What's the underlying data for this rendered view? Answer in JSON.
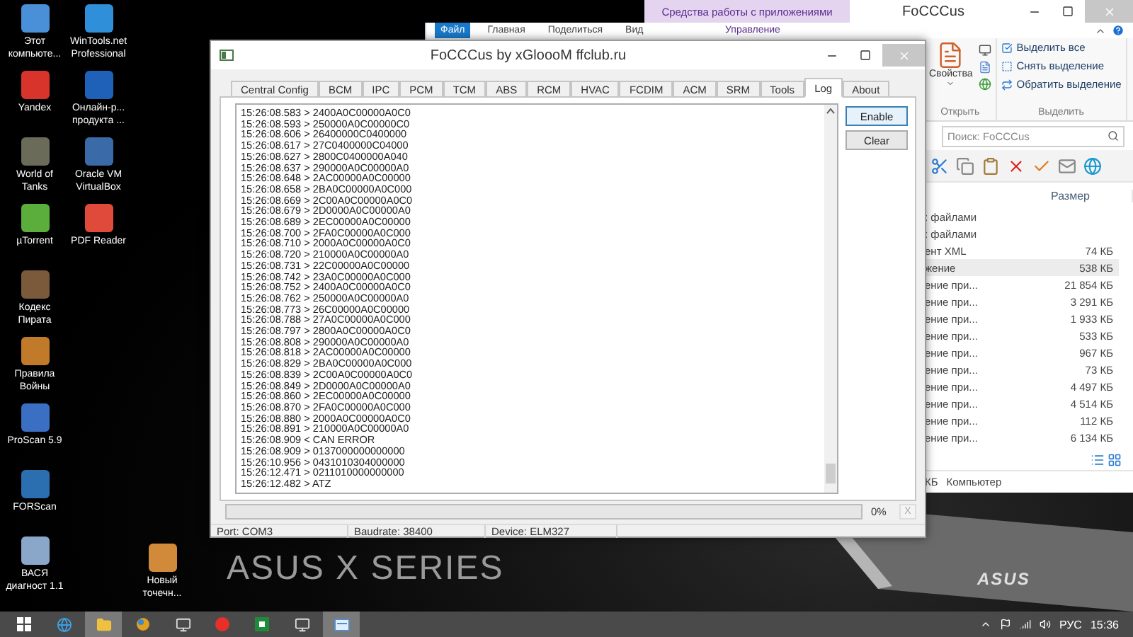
{
  "desktop": {
    "icon_columns": [
      [
        {
          "label": "Этот компьюте..."
        },
        {
          "label": "Yandex"
        },
        {
          "label": "World of Tanks"
        },
        {
          "label": "µTorrent"
        },
        {
          "label": "Кодекс Пирата"
        },
        {
          "label": "Правила Войны"
        },
        {
          "label": "ProScan 5.9"
        },
        {
          "label": "FORScan"
        },
        {
          "label": "ВАСЯ диагност 1.1"
        }
      ],
      [
        {
          "label": "WinTools.net Professional"
        },
        {
          "label": "Онлайн-р... продукта ..."
        },
        {
          "label": "Oracle VM VirtualBox"
        },
        {
          "label": "PDF Reader"
        }
      ],
      [
        {
          "label": "Новый точечн..."
        }
      ]
    ],
    "wallpaper": {
      "brand": "ASUS X SERIES",
      "laptop_logo": "ASUS"
    }
  },
  "explorer": {
    "context_header": "Средства работы с приложениями",
    "title": "FoCCCus",
    "tabs": [
      {
        "label": "Файл",
        "kind": "file"
      },
      {
        "label": "Главная",
        "kind": "plain"
      },
      {
        "label": "Поделиться",
        "kind": "plain"
      },
      {
        "label": "Вид",
        "kind": "plain"
      },
      {
        "label": "Управление",
        "kind": "context"
      }
    ],
    "ribbon": [
      {
        "label": "Открыть",
        "items": [
          {
            "label": "Свойства",
            "kind": "large"
          }
        ]
      },
      {
        "label": "Выделить",
        "items": [
          {
            "label": "Выделить все",
            "kind": "small"
          },
          {
            "label": "Снять выделение",
            "kind": "small"
          },
          {
            "label": "Обратить выделение",
            "kind": "small"
          }
        ]
      }
    ],
    "search": {
      "placeholder": "Поиск: FoCCCus"
    },
    "list": {
      "column": "Размер",
      "rows": [
        {
          "name": ": файлами",
          "selected": false
        },
        {
          "name": ": файлами",
          "selected": false
        },
        {
          "name": "ент XML",
          "size": "74 КБ",
          "selected": false
        },
        {
          "name": "жение",
          "size": "538 КБ",
          "selected": true
        },
        {
          "name": "ение при...",
          "size": "21 854 КБ",
          "selected": false
        },
        {
          "name": "ение при...",
          "size": "3 291 КБ",
          "selected": false
        },
        {
          "name": "ение при...",
          "size": "1 933 КБ",
          "selected": false
        },
        {
          "name": "ение при...",
          "size": "533 КБ",
          "selected": false
        },
        {
          "name": "ение при...",
          "size": "967 КБ",
          "selected": false
        },
        {
          "name": "ение при...",
          "size": "73 КБ",
          "selected": false
        },
        {
          "name": "ение при...",
          "size": "4 497 КБ",
          "selected": false
        },
        {
          "name": "ение при...",
          "size": "4 514 КБ",
          "selected": false
        },
        {
          "name": "ение при...",
          "size": "112 КБ",
          "selected": false
        },
        {
          "name": "ение при...",
          "size": "6 134 КБ",
          "selected": false
        }
      ]
    },
    "status": [
      "КБ",
      "Компьютер"
    ]
  },
  "app": {
    "title": "FoCCCus by xGloooM ffclub.ru",
    "tabs": [
      {
        "label": "Central Config",
        "selected": false
      },
      {
        "label": "BCM",
        "selected": false
      },
      {
        "label": "IPC",
        "selected": false
      },
      {
        "label": "PCM",
        "selected": false
      },
      {
        "label": "TCM",
        "selected": false
      },
      {
        "label": "ABS",
        "selected": false
      },
      {
        "label": "RCM",
        "selected": false
      },
      {
        "label": "HVAC",
        "selected": false
      },
      {
        "label": "FCDIM",
        "selected": false
      },
      {
        "label": "ACM",
        "selected": false
      },
      {
        "label": "SRM",
        "selected": false
      },
      {
        "label": "Tools",
        "selected": false
      },
      {
        "label": "Log",
        "selected": true
      },
      {
        "label": "About",
        "selected": false
      }
    ],
    "log": [
      "15:26:08.583 > 2400A0C00000A0C0",
      "15:26:08.593 > 250000A0C00000C0",
      "15:26:08.606 > 26400000C0400000",
      "15:26:08.617 > 27C0400000C04000",
      "15:26:08.627 > 2800C0400000A040",
      "15:26:08.637 > 290000A0C00000A0",
      "15:26:08.648 > 2AC00000A0C00000",
      "15:26:08.658 > 2BA0C00000A0C000",
      "15:26:08.669 > 2C00A0C00000A0C0",
      "15:26:08.679 > 2D0000A0C00000A0",
      "15:26:08.689 > 2EC00000A0C00000",
      "15:26:08.700 > 2FA0C00000A0C000",
      "15:26:08.710 > 2000A0C00000A0C0",
      "15:26:08.720 > 210000A0C00000A0",
      "15:26:08.731 > 22C00000A0C00000",
      "15:26:08.742 > 23A0C00000A0C000",
      "15:26:08.752 > 2400A0C00000A0C0",
      "15:26:08.762 > 250000A0C00000A0",
      "15:26:08.773 > 26C00000A0C00000",
      "15:26:08.788 > 27A0C00000A0C000",
      "15:26:08.797 > 2800A0C00000A0C0",
      "15:26:08.808 > 290000A0C00000A0",
      "15:26:08.818 > 2AC00000A0C00000",
      "15:26:08.829 > 2BA0C00000A0C000",
      "15:26:08.839 > 2C00A0C00000A0C0",
      "15:26:08.849 > 2D0000A0C00000A0",
      "15:26:08.860 > 2EC00000A0C00000",
      "15:26:08.870 > 2FA0C00000A0C000",
      "15:26:08.880 > 2000A0C00000A0C0",
      "15:26:08.891 > 210000A0C00000A0",
      "15:26:08.909 < CAN ERROR",
      "15:26:08.909 > 0137000000000000",
      "15:26:10.956 > 0431010304000000",
      "15:26:12.471 > 0211010000000000",
      "15:26:12.482 > ATZ"
    ],
    "buttons": [
      {
        "label": "Enable",
        "default": true
      },
      {
        "label": "Clear",
        "default": false
      }
    ],
    "progress": {
      "level": 0,
      "reading": "0%",
      "cancel": {
        "label": "X",
        "disabled": true
      }
    },
    "status_bar": [
      "Port: COM3",
      "Baudrate: 38400",
      "Device: ELM327"
    ]
  },
  "taskbar": {
    "items": [
      {
        "kind": "start",
        "selected": false
      },
      {
        "kind": "browser",
        "selected": false
      },
      {
        "kind": "folder",
        "selected": true
      },
      {
        "kind": "ball",
        "selected": false
      },
      {
        "kind": "window",
        "selected": false
      },
      {
        "kind": "yandex",
        "selected": false
      },
      {
        "kind": "sheet",
        "selected": false
      },
      {
        "kind": "window",
        "selected": false
      },
      {
        "kind": "app",
        "selected": true
      }
    ],
    "language": "РУС",
    "time": "15:36"
  }
}
